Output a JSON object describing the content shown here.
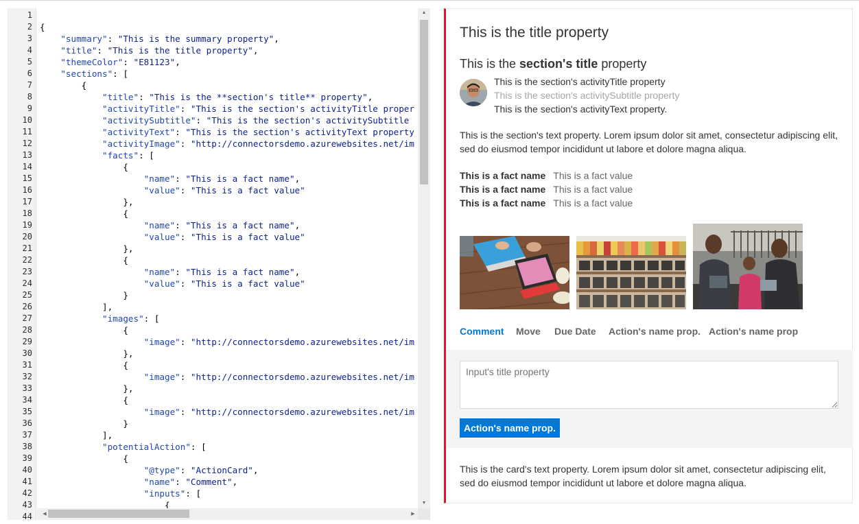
{
  "editor": {
    "lines": [
      [
        {
          "t": ""
        }
      ],
      [
        {
          "t": "{"
        }
      ],
      [
        {
          "t": "    "
        },
        {
          "t": "\"summary\"",
          "c": "k"
        },
        {
          "t": ": "
        },
        {
          "t": "\"This is the summary property\"",
          "c": "s"
        },
        {
          "t": ","
        }
      ],
      [
        {
          "t": "    "
        },
        {
          "t": "\"title\"",
          "c": "k"
        },
        {
          "t": ": "
        },
        {
          "t": "\"This is the title property\"",
          "c": "s"
        },
        {
          "t": ","
        }
      ],
      [
        {
          "t": "    "
        },
        {
          "t": "\"themeColor\"",
          "c": "k"
        },
        {
          "t": ": "
        },
        {
          "t": "\"E81123\"",
          "c": "s"
        },
        {
          "t": ","
        }
      ],
      [
        {
          "t": "    "
        },
        {
          "t": "\"sections\"",
          "c": "k"
        },
        {
          "t": ": ["
        }
      ],
      [
        {
          "t": "        {"
        }
      ],
      [
        {
          "t": "            "
        },
        {
          "t": "\"title\"",
          "c": "k"
        },
        {
          "t": ": "
        },
        {
          "t": "\"This is the **section's title** property\"",
          "c": "s"
        },
        {
          "t": ","
        }
      ],
      [
        {
          "t": "            "
        },
        {
          "t": "\"activityTitle\"",
          "c": "k"
        },
        {
          "t": ": "
        },
        {
          "t": "\"This is the section's activityTitle proper",
          "c": "s"
        }
      ],
      [
        {
          "t": "            "
        },
        {
          "t": "\"activitySubtitle\"",
          "c": "k"
        },
        {
          "t": ": "
        },
        {
          "t": "\"This is the section's activitySubtitle",
          "c": "s"
        }
      ],
      [
        {
          "t": "            "
        },
        {
          "t": "\"activityText\"",
          "c": "k"
        },
        {
          "t": ": "
        },
        {
          "t": "\"This is the section's activityText property",
          "c": "s"
        }
      ],
      [
        {
          "t": "            "
        },
        {
          "t": "\"activityImage\"",
          "c": "k"
        },
        {
          "t": ": "
        },
        {
          "t": "\"http://connectorsdemo.azurewebsites.net/im",
          "c": "s"
        }
      ],
      [
        {
          "t": "            "
        },
        {
          "t": "\"facts\"",
          "c": "k"
        },
        {
          "t": ": ["
        }
      ],
      [
        {
          "t": "                {"
        }
      ],
      [
        {
          "t": "                    "
        },
        {
          "t": "\"name\"",
          "c": "k"
        },
        {
          "t": ": "
        },
        {
          "t": "\"This is a fact name\"",
          "c": "s"
        },
        {
          "t": ","
        }
      ],
      [
        {
          "t": "                    "
        },
        {
          "t": "\"value\"",
          "c": "k"
        },
        {
          "t": ": "
        },
        {
          "t": "\"This is a fact value\"",
          "c": "s"
        }
      ],
      [
        {
          "t": "                },"
        }
      ],
      [
        {
          "t": "                {"
        }
      ],
      [
        {
          "t": "                    "
        },
        {
          "t": "\"name\"",
          "c": "k"
        },
        {
          "t": ": "
        },
        {
          "t": "\"This is a fact name\"",
          "c": "s"
        },
        {
          "t": ","
        }
      ],
      [
        {
          "t": "                    "
        },
        {
          "t": "\"value\"",
          "c": "k"
        },
        {
          "t": ": "
        },
        {
          "t": "\"This is a fact value\"",
          "c": "s"
        }
      ],
      [
        {
          "t": "                },"
        }
      ],
      [
        {
          "t": "                {"
        }
      ],
      [
        {
          "t": "                    "
        },
        {
          "t": "\"name\"",
          "c": "k"
        },
        {
          "t": ": "
        },
        {
          "t": "\"This is a fact name\"",
          "c": "s"
        },
        {
          "t": ","
        }
      ],
      [
        {
          "t": "                    "
        },
        {
          "t": "\"value\"",
          "c": "k"
        },
        {
          "t": ": "
        },
        {
          "t": "\"This is a fact value\"",
          "c": "s"
        }
      ],
      [
        {
          "t": "                }"
        }
      ],
      [
        {
          "t": "            ],"
        }
      ],
      [
        {
          "t": "            "
        },
        {
          "t": "\"images\"",
          "c": "k"
        },
        {
          "t": ": ["
        }
      ],
      [
        {
          "t": "                {"
        }
      ],
      [
        {
          "t": "                    "
        },
        {
          "t": "\"image\"",
          "c": "k"
        },
        {
          "t": ": "
        },
        {
          "t": "\"http://connectorsdemo.azurewebsites.net/im",
          "c": "s"
        }
      ],
      [
        {
          "t": "                },"
        }
      ],
      [
        {
          "t": "                {"
        }
      ],
      [
        {
          "t": "                    "
        },
        {
          "t": "\"image\"",
          "c": "k"
        },
        {
          "t": ": "
        },
        {
          "t": "\"http://connectorsdemo.azurewebsites.net/im",
          "c": "s"
        }
      ],
      [
        {
          "t": "                },"
        }
      ],
      [
        {
          "t": "                {"
        }
      ],
      [
        {
          "t": "                    "
        },
        {
          "t": "\"image\"",
          "c": "k"
        },
        {
          "t": ": "
        },
        {
          "t": "\"http://connectorsdemo.azurewebsites.net/im",
          "c": "s"
        }
      ],
      [
        {
          "t": "                }"
        }
      ],
      [
        {
          "t": "            ],"
        }
      ],
      [
        {
          "t": "            "
        },
        {
          "t": "\"potentialAction\"",
          "c": "k"
        },
        {
          "t": ": ["
        }
      ],
      [
        {
          "t": "                {"
        }
      ],
      [
        {
          "t": "                    "
        },
        {
          "t": "\"@type\"",
          "c": "k"
        },
        {
          "t": ": "
        },
        {
          "t": "\"ActionCard\"",
          "c": "s"
        },
        {
          "t": ","
        }
      ],
      [
        {
          "t": "                    "
        },
        {
          "t": "\"name\"",
          "c": "k"
        },
        {
          "t": ": "
        },
        {
          "t": "\"Comment\"",
          "c": "s"
        },
        {
          "t": ","
        }
      ],
      [
        {
          "t": "                    "
        },
        {
          "t": "\"inputs\"",
          "c": "k"
        },
        {
          "t": ": ["
        }
      ],
      [
        {
          "t": "                        {"
        }
      ],
      [
        {
          "t": ""
        }
      ]
    ]
  },
  "card": {
    "theme_color": "#E81123",
    "title": "This is the title property",
    "section": {
      "title_before": "This is the ",
      "title_bold": "section's title",
      "title_after": " property",
      "activity_title": "This is the section's activityTitle property",
      "activity_subtitle": "This is the section's activitySubtitle property",
      "activity_text": "This is the section's activityText property.",
      "text": "This is the section's text property. Lorem ipsum dolor sit amet, consectetur adipiscing elit, sed do eiusmod tempor incididunt ut labore et dolore magna aliqua.",
      "facts": [
        {
          "name": "This is a fact name",
          "value": "This is a fact value"
        },
        {
          "name": "This is a fact name",
          "value": "This is a fact value"
        },
        {
          "name": "This is a fact name",
          "value": "This is a fact value"
        }
      ]
    },
    "actions": [
      "Comment",
      "Move",
      "Due Date",
      "Action's name prop.",
      "Action's name prop"
    ],
    "input_placeholder": "Input's title property",
    "submit_label": "Action's name prop.",
    "text": "This is the card's text property. Lorem ipsum dolor sit amet, consectetur adipiscing elit, sed do eiusmod tempor incididunt ut labore et dolore magna aliqua."
  }
}
